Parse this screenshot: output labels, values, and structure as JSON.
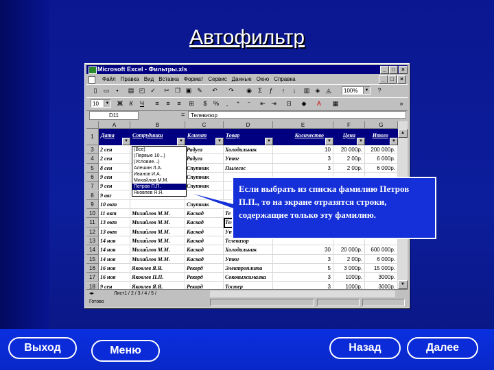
{
  "slide": {
    "title": "Автофильтр"
  },
  "excel": {
    "window_title": "Microsoft Excel - Фильтры.xls",
    "menu": [
      "Файл",
      "Правка",
      "Вид",
      "Вставка",
      "Формат",
      "Сервис",
      "Данные",
      "Окно",
      "Справка"
    ],
    "zoom": "100%",
    "font_size": "10",
    "name_box": "D11",
    "formula_content": "Телевизор",
    "columns": [
      "A",
      "B",
      "C",
      "D",
      "E",
      "F",
      "G"
    ],
    "header_row": [
      "Дата",
      "Сотрудники",
      "Клиент",
      "Товар",
      "Количество",
      "Цена",
      "Итого"
    ],
    "rows": [
      {
        "n": "3",
        "cells": [
          "2 сен",
          "",
          "Радуга",
          "Холодильник",
          "10",
          "20 000р.",
          "200 000р."
        ]
      },
      {
        "n": "4",
        "cells": [
          "2 сен",
          "",
          "Радуга",
          "Утюг",
          "3",
          "2 00р.",
          "6 000р."
        ]
      },
      {
        "n": "5",
        "cells": [
          "8 сен",
          "",
          "Спутник",
          "Пылесос",
          "3",
          "2 00р.",
          "6 000р."
        ]
      },
      {
        "n": "6",
        "cells": [
          "9 сен",
          "",
          "Спутник",
          "",
          "",
          "",
          ""
        ]
      },
      {
        "n": "7",
        "cells": [
          "9 сен",
          "",
          "Спутник",
          "",
          "",
          "",
          ""
        ]
      },
      {
        "n": "8",
        "cells": [
          "9 авг",
          "",
          "",
          "",
          "",
          "",
          ""
        ]
      },
      {
        "n": "9",
        "cells": [
          "10 окт",
          "",
          "Спутник",
          "",
          "",
          "",
          ""
        ]
      },
      {
        "n": "10",
        "cells": [
          "11 окт",
          "Михайлов М.М.",
          "Каскад",
          "Те",
          "",
          "",
          ""
        ]
      },
      {
        "n": "11",
        "cells": [
          "13 окт",
          "Михайлов М.М.",
          "Каскад",
          "Телевизор",
          "",
          "",
          ""
        ]
      },
      {
        "n": "12",
        "cells": [
          "13 окт",
          "Михайлов М.М.",
          "Каскад",
          "Ут",
          "",
          "",
          ""
        ]
      },
      {
        "n": "13",
        "cells": [
          "14 ноя",
          "Михайлов М.М.",
          "Каскад",
          "Телевизор",
          "",
          "",
          ""
        ]
      },
      {
        "n": "14",
        "cells": [
          "14 ноя",
          "Михайлов М.М.",
          "Каскад",
          "Холодильник",
          "30",
          "20 000р.",
          "600 000р."
        ]
      },
      {
        "n": "15",
        "cells": [
          "14 ноя",
          "Михайлов М.М.",
          "Каскад",
          "Утюг",
          "3",
          "2 00р.",
          "6 000р."
        ]
      },
      {
        "n": "16",
        "cells": [
          "16 ноя",
          "Яковлев Я.Я.",
          "Рекорд",
          "Электроплита",
          "5",
          "3 000р.",
          "15 000р."
        ]
      },
      {
        "n": "17",
        "cells": [
          "16 ноя",
          "Яковлев П.П.",
          "Рекорд",
          "Соковыжималка",
          "3",
          "1000р.",
          "3000р."
        ]
      },
      {
        "n": "18",
        "cells": [
          "9 сен",
          "Яковлев Я.Я.",
          "Рекорд",
          "Тостер",
          "3",
          "1000р.",
          "3000р."
        ]
      }
    ],
    "filter_options": [
      "(Все)",
      "(Первые 10...)",
      "(Условие...)",
      "Алешин Л.А.",
      "Иванов И.А.",
      "Михайлов М.М.",
      "Петров П.П.",
      "Яковлев Я.Я."
    ],
    "selected_option_index": 6,
    "sheet_tabs": "Лист1 / 2 / 3 / 4 / 5 /",
    "status": "Готово"
  },
  "callout_text": "Если выбрать из списка фамилию Петров П.П., то на экране отразятся строки, содержащие только эту фамилию.",
  "nav": {
    "exit": "Выход",
    "menu": "Меню",
    "back": "Назад",
    "next": "Далее"
  }
}
